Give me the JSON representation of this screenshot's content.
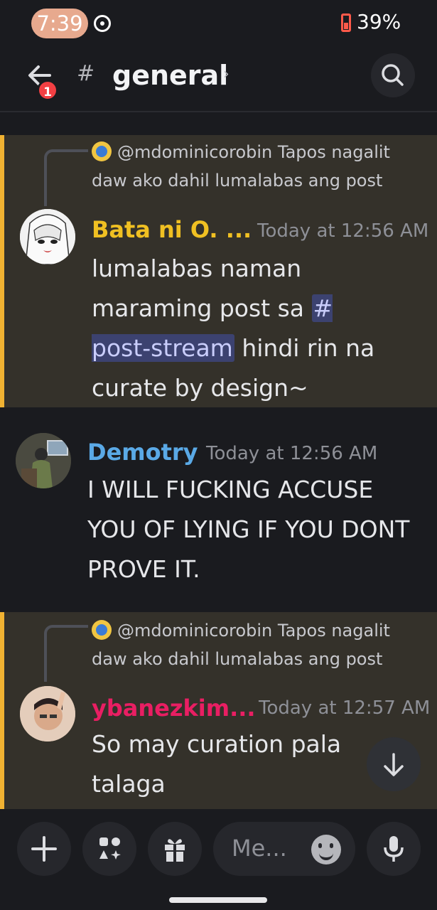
{
  "status_bar": {
    "time": "7:39",
    "battery": "39%"
  },
  "header": {
    "channel": "general",
    "notification_count": "1"
  },
  "messages": [
    {
      "reply_to": {
        "mention": "@mdominicorobin",
        "text": "Tapos nagalit daw ako dahil lumalabas ang post"
      },
      "author": "Bata ni O. ...",
      "author_color": "#f0c022",
      "timestamp": "Today at 12:56 AM",
      "text_before": "lumalabas naman maraming post sa",
      "channel_mention_hash": "#",
      "channel_mention_name": "post-stream",
      "text_after": "hindi rin na curate by design~",
      "highlighted": true
    },
    {
      "author": "Demotry",
      "author_color": "#5aa9e6",
      "timestamp": "Today at 12:56 AM",
      "text": "I WILL FUCKING ACCUSE YOU OF LYING IF YOU DONT PROVE IT.",
      "highlighted": false
    },
    {
      "reply_to": {
        "mention": "@mdominicorobin",
        "text": "Tapos nagalit daw ako dahil lumalabas ang post"
      },
      "author": "ybanezkim...",
      "author_color": "#e91e63",
      "timestamp": "Today at 12:57 AM",
      "text": "So may curation pala talaga",
      "highlighted": true
    }
  ],
  "composer": {
    "placeholder": "Me..."
  },
  "colors": {
    "mention_highlight_bg": "#34312a",
    "mention_bar": "#f0b232",
    "badge": "#f23f43"
  }
}
